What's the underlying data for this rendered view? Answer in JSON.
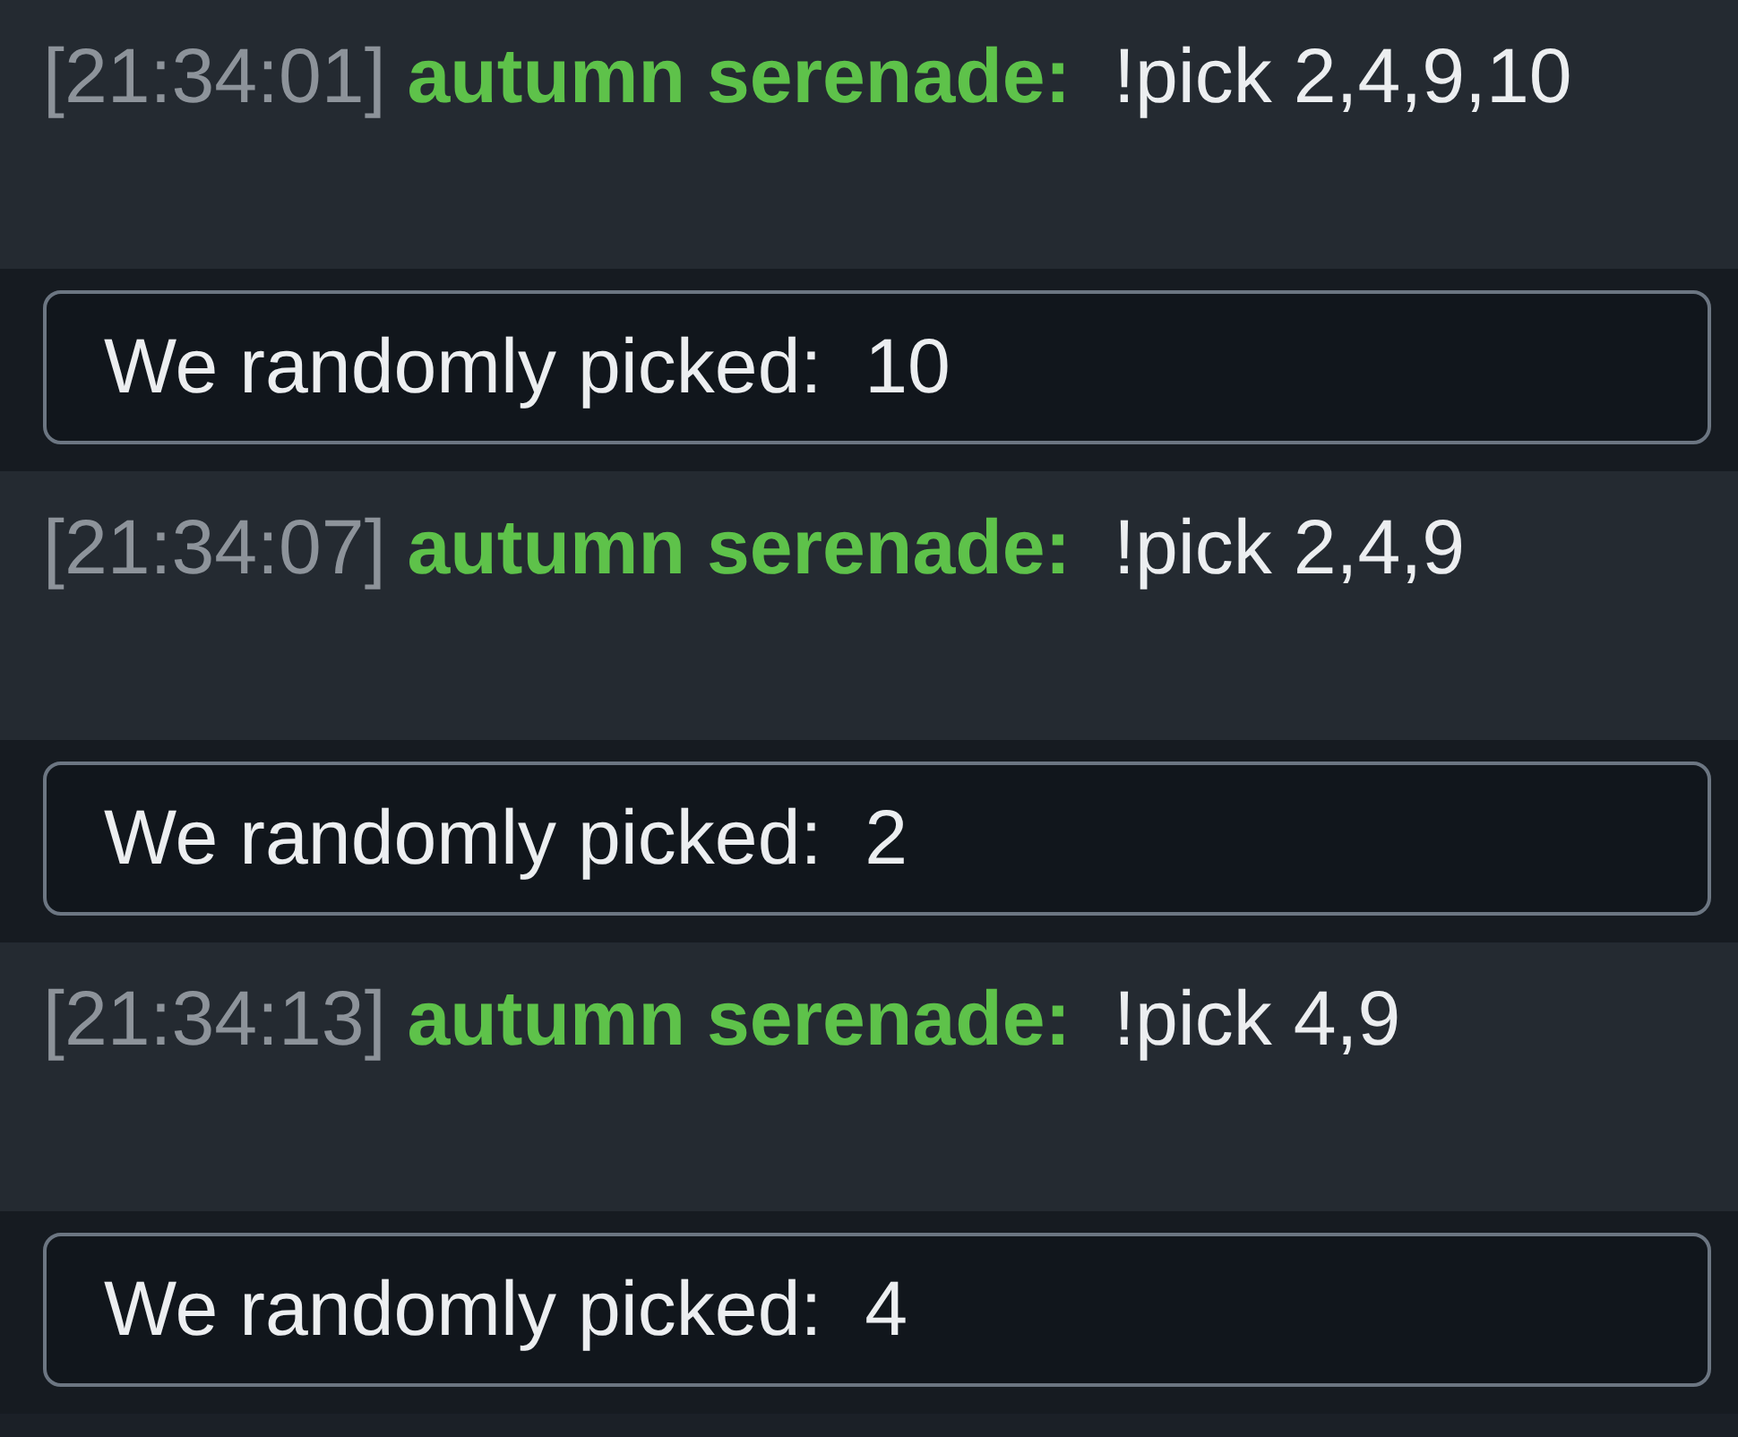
{
  "messages": [
    {
      "kind": "chat",
      "time": "[21:34:01]",
      "user": "autumn serenade:",
      "text": "!pick 2,4,9,10"
    },
    {
      "kind": "bot",
      "label": "We randomly picked:",
      "value": "10"
    },
    {
      "kind": "chat",
      "time": "[21:34:07]",
      "user": "autumn serenade:",
      "text": "!pick 2,4,9"
    },
    {
      "kind": "bot",
      "label": "We randomly picked:",
      "value": "2"
    },
    {
      "kind": "chat",
      "time": "[21:34:13]",
      "user": "autumn serenade:",
      "text": "!pick 4,9"
    },
    {
      "kind": "bot",
      "label": "We randomly picked:",
      "value": "4"
    }
  ]
}
